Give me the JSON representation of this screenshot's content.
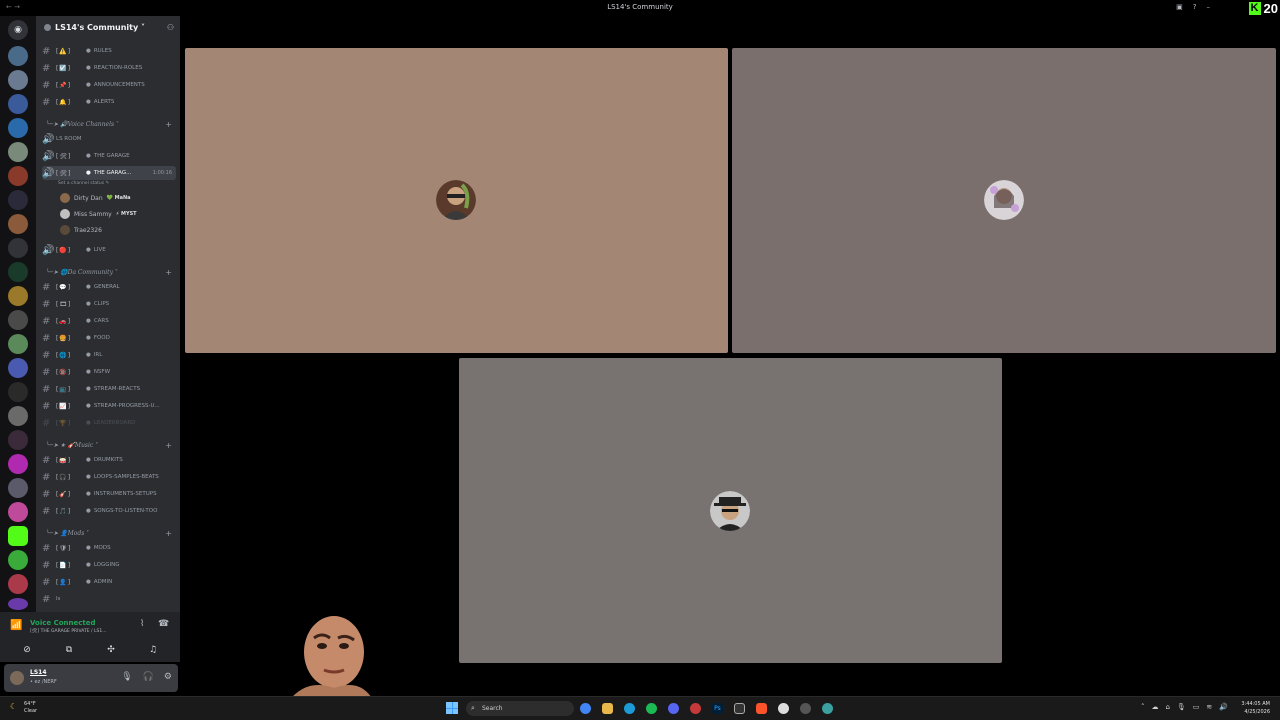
{
  "window": {
    "title": "LS14's Community",
    "nav": "← →"
  },
  "kick": {
    "logo": "K",
    "count": "20"
  },
  "server": {
    "name": "LS14's Community ˅"
  },
  "text_channels_top": [
    {
      "emoji": "[⚠️]",
      "name": "RULES"
    },
    {
      "emoji": "[☑️]",
      "name": "REACTION-ROLES"
    },
    {
      "emoji": "[📌]",
      "name": "ANNOUNCEMENTS"
    },
    {
      "emoji": "[🔔]",
      "name": "ALERTS"
    }
  ],
  "cat_voice": "Voice Channels ˅",
  "ls_room": "LS ROOM",
  "garage1": {
    "emoji": "[🛠]",
    "name": "THE GARAGE"
  },
  "garage2": {
    "emoji": "[🛠]",
    "name": "THE GARAG...",
    "time": "1:00:16",
    "status": "Set a channel status ✎"
  },
  "voice_users": [
    {
      "name": "Dirty Dan",
      "tag": "💚 MaNa"
    },
    {
      "name": "Miss Sammy",
      "tag": "⚡ MYST"
    },
    {
      "name": "Trae2326",
      "tag": ""
    }
  ],
  "live": {
    "emoji": "[🔴]",
    "name": "LIVE"
  },
  "cat_community": "Da Community ˅",
  "community_channels": [
    {
      "emoji": "[💬]",
      "name": "GENERAL"
    },
    {
      "emoji": "[🎞]",
      "name": "CLIPS"
    },
    {
      "emoji": "[🚗]",
      "name": "CARS"
    },
    {
      "emoji": "[🍔]",
      "name": "FOOD"
    },
    {
      "emoji": "[🌐]",
      "name": "IRL"
    },
    {
      "emoji": "[🔞]",
      "name": "NSFW"
    },
    {
      "emoji": "[📺]",
      "name": "STREAM-REACTS"
    },
    {
      "emoji": "[📈]",
      "name": "STREAM-PROGRESS-U..."
    },
    {
      "emoji": "[🏆]",
      "name": "LEADERBOARD"
    }
  ],
  "cat_music": "Music ˅",
  "music_channels": [
    {
      "emoji": "[🥁]",
      "name": "DRUMKITS"
    },
    {
      "emoji": "[🎧]",
      "name": "LOOPS-SAMPLES-BEATS"
    },
    {
      "emoji": "[🎸]",
      "name": "INSTRUMENTS-SETUPS"
    },
    {
      "emoji": "[🎵]",
      "name": "SONGS-TO-LISTEN-TOO"
    }
  ],
  "cat_mods": "Mods ˅",
  "mod_channels": [
    {
      "emoji": "[🛡]",
      "name": "MODS"
    },
    {
      "emoji": "[📄]",
      "name": "LOGGING"
    },
    {
      "emoji": "[👤]",
      "name": "ADMIN"
    }
  ],
  "ls_channel": "ls",
  "voice_panel": {
    "title": "Voice Connected",
    "sub": "[🛠] THE GARAGE PRIVATE / LS1..."
  },
  "user": {
    "name": "LS14",
    "status": "• ez /NERF"
  },
  "colors": {
    "tile1": "#a48674",
    "tile2": "#7a6f6d",
    "tile3": "#787370",
    "accent": "#23a55a"
  },
  "taskbar": {
    "search": "Search",
    "weather_temp": "64°F",
    "weather_cond": "Clear",
    "time": "3:44:05 AM",
    "date": "4/25/2026"
  }
}
